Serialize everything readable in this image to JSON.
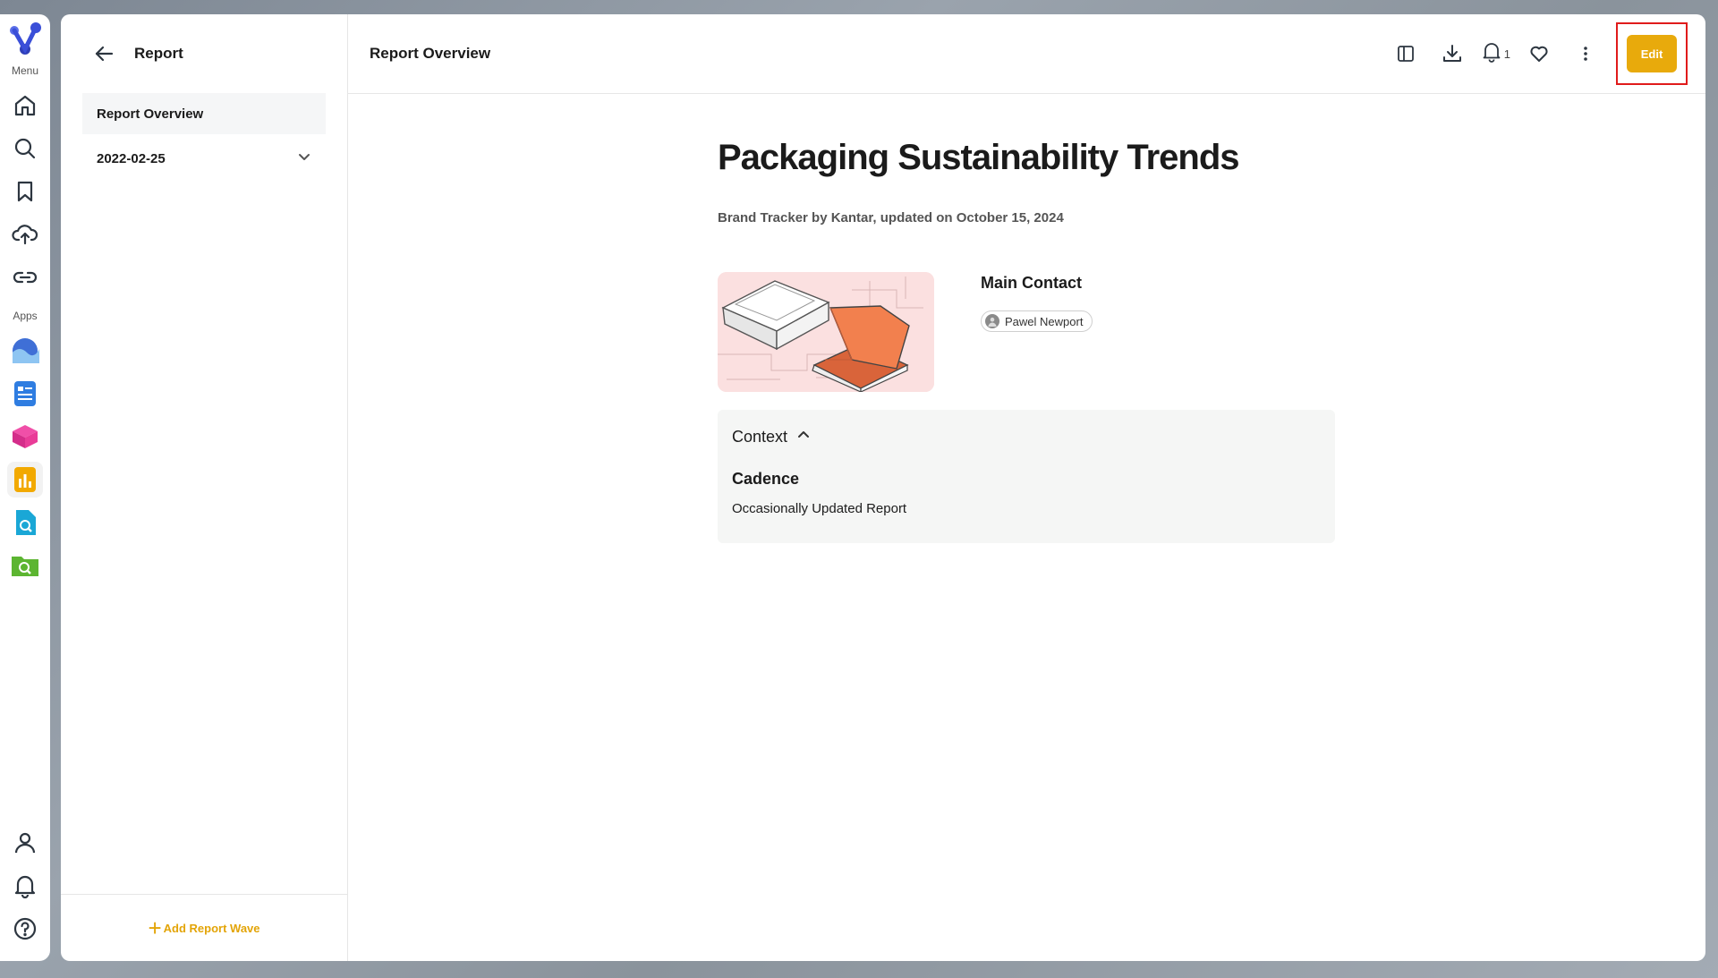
{
  "rail": {
    "menu_label": "Menu",
    "apps_label": "Apps",
    "nav_icons": [
      "home-icon",
      "search-icon",
      "bookmark-icon",
      "upload-cloud-icon",
      "link-icon"
    ],
    "app_icons": [
      "wave-app-icon",
      "document-app-icon",
      "cube-app-icon",
      "chart-app-icon",
      "file-search-app-icon",
      "folder-search-app-icon"
    ],
    "bottom_icons": [
      "user-icon",
      "bell-icon",
      "help-icon"
    ]
  },
  "left_panel": {
    "title": "Report",
    "items": [
      {
        "label": "Report Overview",
        "selected": true
      },
      {
        "label": "2022-02-25",
        "selected": false
      }
    ],
    "add_wave_label": "Add Report Wave"
  },
  "top_bar": {
    "page_title": "Report Overview",
    "notification_count": "1",
    "edit_label": "Edit"
  },
  "main": {
    "title": "Packaging Sustainability Trends",
    "subtitle": "Brand Tracker by Kantar, updated on October 15, 2024",
    "contact_heading": "Main Contact",
    "contact_name": "Pawel Newport",
    "context_label": "Context",
    "cadence_label": "Cadence",
    "cadence_value": "Occasionally Updated Report"
  },
  "colors": {
    "accent": "#e8aa0c",
    "highlight_frame": "#e01b1b",
    "thumb_orange": "#f2804e",
    "logo_blue": "#3a4fd8"
  }
}
